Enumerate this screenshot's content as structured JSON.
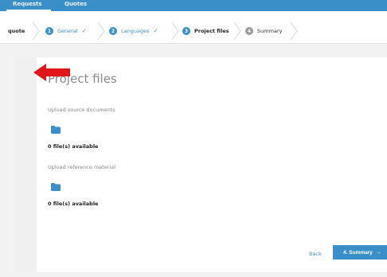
{
  "topnav": {
    "tabs": [
      {
        "label": "Requests"
      },
      {
        "label": "Quotes"
      }
    ]
  },
  "steps": [
    {
      "label": "quote"
    },
    {
      "number": "1",
      "label": "General",
      "status": "complete"
    },
    {
      "number": "2",
      "label": "Languages",
      "status": "complete"
    },
    {
      "number": "3",
      "label": "Project files",
      "status": "current"
    },
    {
      "number": "4",
      "label": "Summary",
      "status": "upcoming"
    }
  ],
  "main": {
    "title": "Project files",
    "source": {
      "label": "Upload source documents",
      "icon": "folder-icon",
      "count_text": "0 file(s) available"
    },
    "reference": {
      "label": "Upload reference material",
      "icon": "folder-icon",
      "count_text": "0 file(s) available"
    }
  },
  "footer": {
    "back_label": "Back",
    "next_label": "4. Summary"
  },
  "colors": {
    "accent": "#3b8fc8",
    "arrow": "#e0161b",
    "muted_text": "#8a8a8a"
  }
}
